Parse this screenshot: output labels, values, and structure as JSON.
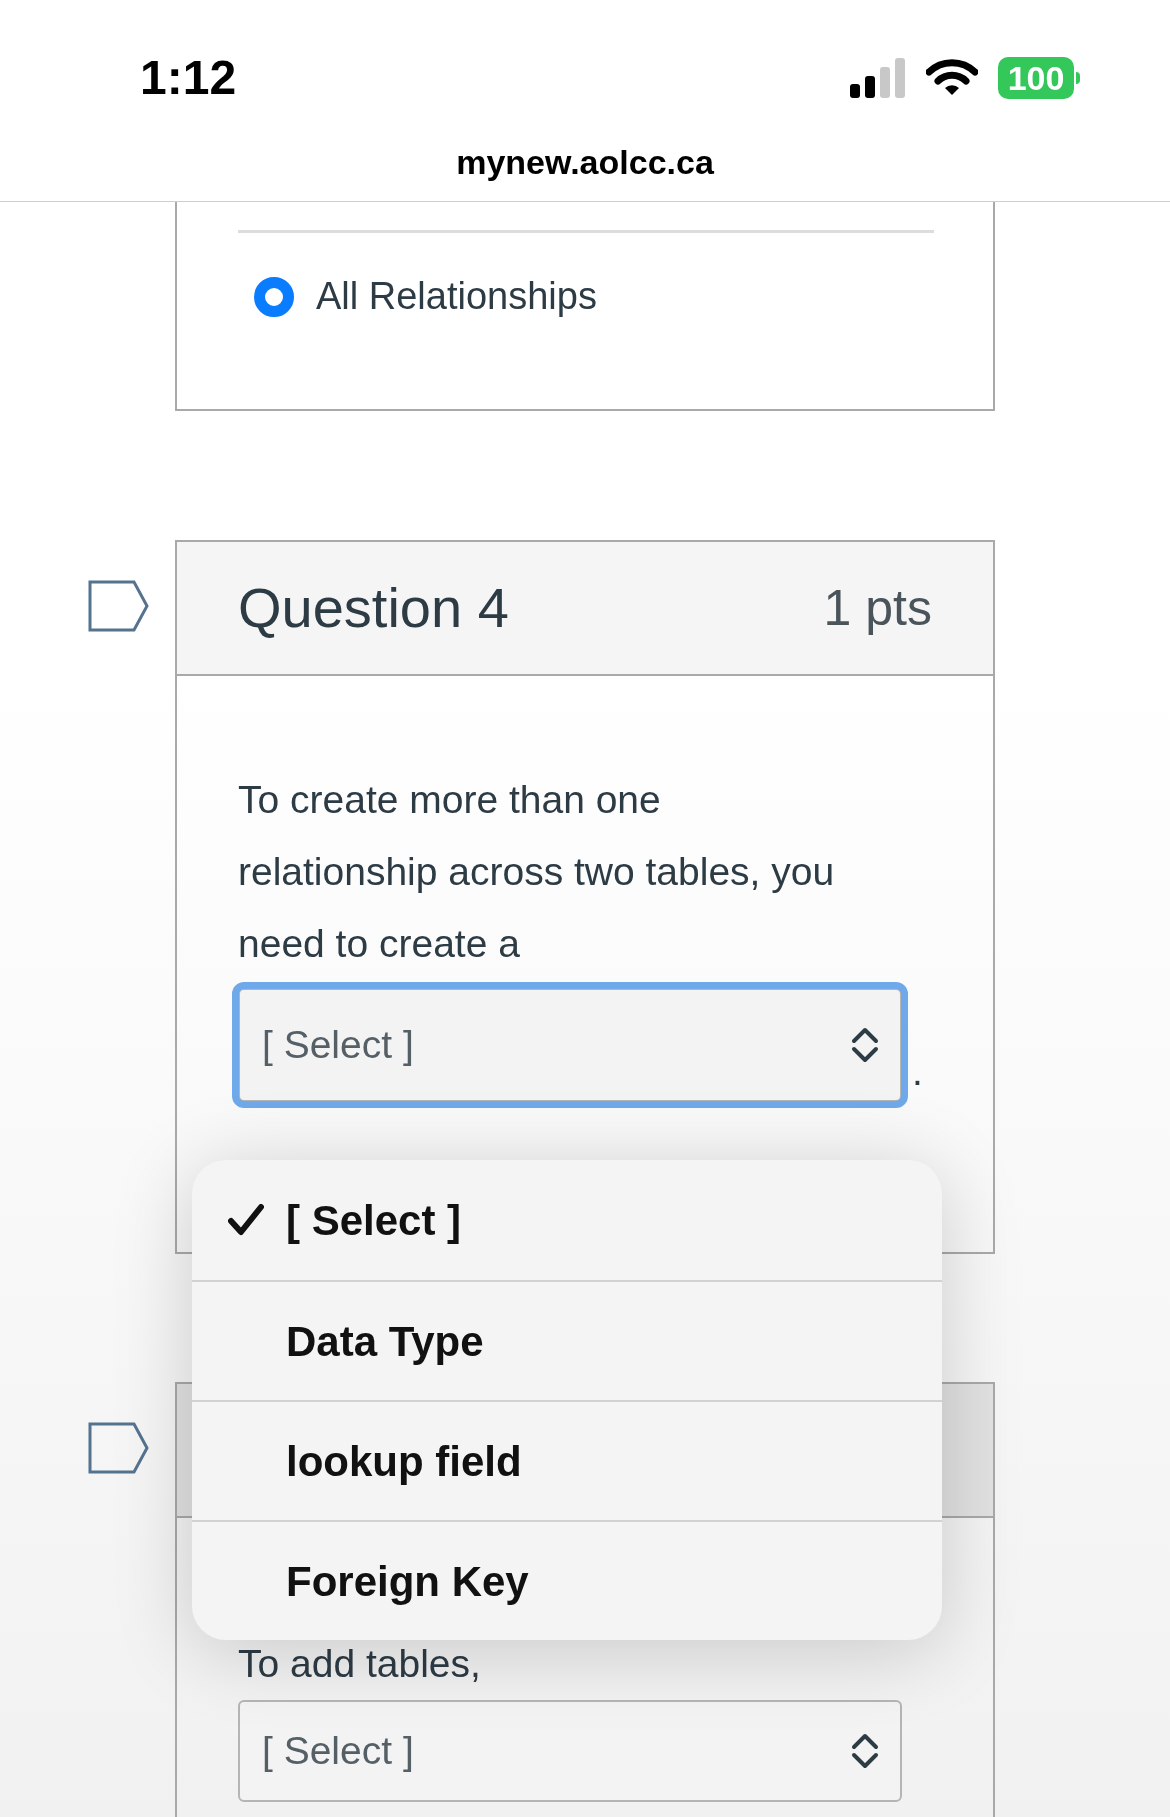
{
  "status_bar": {
    "time": "1:12",
    "battery": "100"
  },
  "address_bar": {
    "url": "mynew.aolcc.ca"
  },
  "previous_question": {
    "options": [
      {
        "label": "All Relationships",
        "selected": true
      }
    ]
  },
  "questions": [
    {
      "title": "Question 4",
      "points": "1 pts",
      "prompt": "To create more than one relationship across two tables, you need to create a",
      "prompt_end": ".",
      "select": {
        "value": "[ Select ]",
        "focused": true
      }
    },
    {
      "prompt": "To add tables,",
      "select": {
        "value": "[ Select ]",
        "focused": false
      }
    }
  ],
  "dropdown_menu": {
    "options": [
      {
        "label": "[ Select ]",
        "selected": true
      },
      {
        "label": "Data Type",
        "selected": false
      },
      {
        "label": "lookup field",
        "selected": false
      },
      {
        "label": "Foreign Key",
        "selected": false
      }
    ]
  }
}
